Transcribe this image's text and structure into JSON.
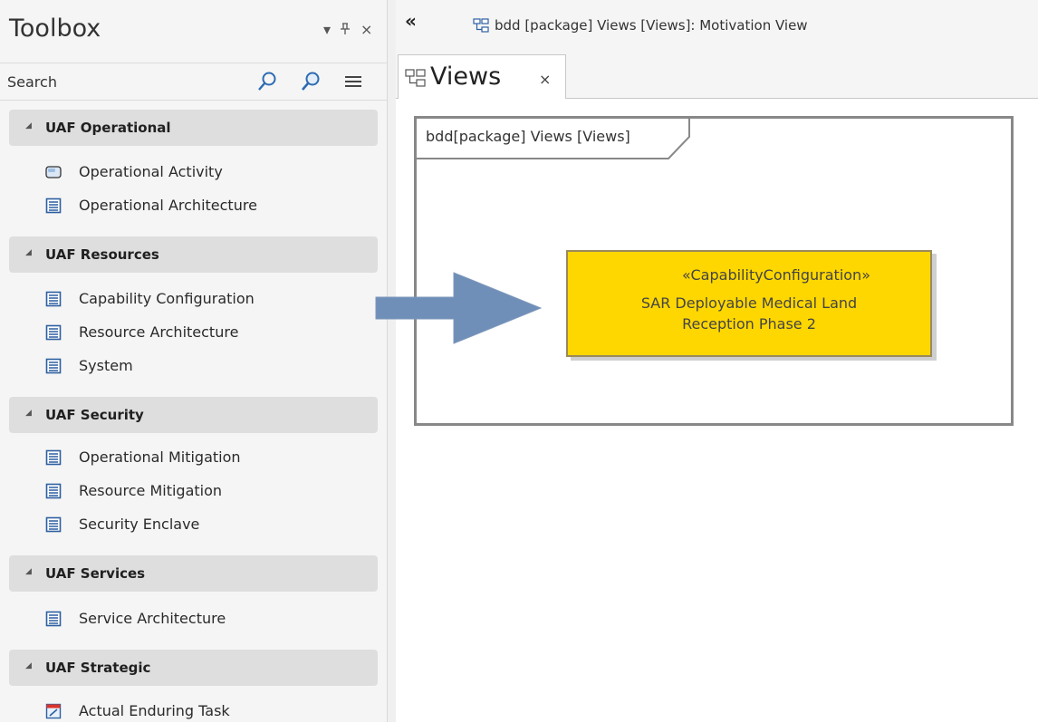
{
  "toolbox": {
    "title": "Toolbox",
    "controls": {
      "dropdown": "▾",
      "pin": "ꟼ",
      "close": "×"
    },
    "search": {
      "placeholder": "Search",
      "value": ""
    },
    "groups": [
      {
        "label": "UAF Operational",
        "items": [
          {
            "label": "Operational Activity",
            "icon": "activity-icon"
          },
          {
            "label": "Operational Architecture",
            "icon": "architecture-icon"
          }
        ]
      },
      {
        "label": "UAF Resources",
        "items": [
          {
            "label": "Capability Configuration",
            "icon": "architecture-icon"
          },
          {
            "label": "Resource Architecture",
            "icon": "architecture-icon"
          },
          {
            "label": "System",
            "icon": "architecture-icon"
          }
        ]
      },
      {
        "label": "UAF Security",
        "items": [
          {
            "label": "Operational Mitigation",
            "icon": "architecture-icon"
          },
          {
            "label": "Resource Mitigation",
            "icon": "architecture-icon"
          },
          {
            "label": "Security Enclave",
            "icon": "architecture-icon"
          }
        ]
      },
      {
        "label": "UAF Services",
        "items": [
          {
            "label": "Service Architecture",
            "icon": "architecture-icon"
          }
        ]
      },
      {
        "label": "UAF Strategic",
        "items": [
          {
            "label": "Actual Enduring Task",
            "icon": "enduring-task-icon"
          }
        ]
      }
    ]
  },
  "diagram": {
    "collapse": "«",
    "title": "bdd [package] Views [Views]: Motivation View",
    "tab": {
      "label": "Views",
      "close": "×"
    },
    "frame_label": "bdd[package] Views [Views]",
    "element": {
      "stereotype": "«CapabilityConfiguration»",
      "name": "SAR Deployable Medical Land Reception Phase 2",
      "fill": "#ffd700"
    },
    "arrow_color": "#6f8fb8"
  }
}
